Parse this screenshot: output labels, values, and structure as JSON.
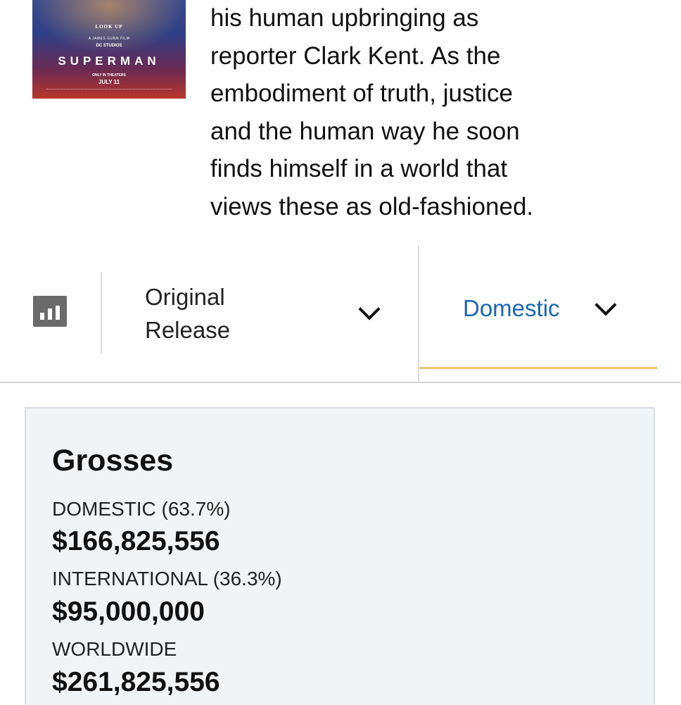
{
  "poster": {
    "tagline": "LOOK UP",
    "film_line": "A JAMES GUNN FILM",
    "studio": "DC STUDIOS",
    "title": "SUPERMAN",
    "only_in_theaters": "ONLY IN THEATERS",
    "release_date": "JULY 11"
  },
  "synopsis": {
    "lines": [
      "his human upbringing as",
      "reporter Clark Kent. As the",
      "embodiment of truth, justice",
      "and the human way he soon",
      "finds himself in a world that",
      "views these as old-fashioned."
    ]
  },
  "filters": {
    "chart_toggle_icon": "bar-chart-icon",
    "release": {
      "line1": "Original",
      "line2": "Release"
    },
    "region": {
      "label": "Domestic",
      "color": "#1a66b3",
      "active_underline_color": "#f1c66a"
    }
  },
  "grosses": {
    "heading": "Grosses",
    "domestic": {
      "label": "DOMESTIC (63.7%)",
      "value": "$166,825,556"
    },
    "international": {
      "label": "INTERNATIONAL (36.3%)",
      "value": "$95,000,000"
    },
    "worldwide": {
      "label": "WORLDWIDE",
      "value": "$261,825,556"
    }
  }
}
